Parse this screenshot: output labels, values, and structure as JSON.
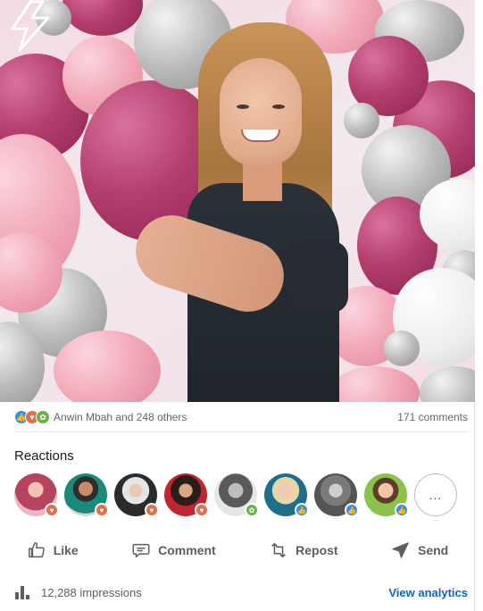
{
  "post": {
    "reaction_icons": [
      "like-icon",
      "love-icon",
      "support-icon"
    ],
    "reactors_text": "Anwin Mbah and 248 others",
    "comments_text": "171 comments"
  },
  "reactions_section": {
    "title": "Reactions",
    "more_label": "...",
    "avatars": [
      {
        "badge": "love",
        "color": "#b8435f"
      },
      {
        "badge": "love",
        "color": "#1a8a7a"
      },
      {
        "badge": "love",
        "color": "#2b2b2b"
      },
      {
        "badge": "love",
        "color": "#c3242f"
      },
      {
        "badge": "support",
        "color": "#7a7a7a"
      },
      {
        "badge": "like",
        "color": "#1f6f8b"
      },
      {
        "badge": "like",
        "color": "#555555"
      },
      {
        "badge": "like",
        "color": "#8bc24a"
      }
    ]
  },
  "actions": {
    "like": "Like",
    "comment": "Comment",
    "repost": "Repost",
    "send": "Send"
  },
  "footer": {
    "impressions": "12,288 impressions",
    "view_analytics": "View analytics"
  },
  "colors": {
    "link_blue": "#0a66c2",
    "like_blue": "#378fe9",
    "love_orange": "#df704d",
    "support_green": "#6dae4f"
  }
}
